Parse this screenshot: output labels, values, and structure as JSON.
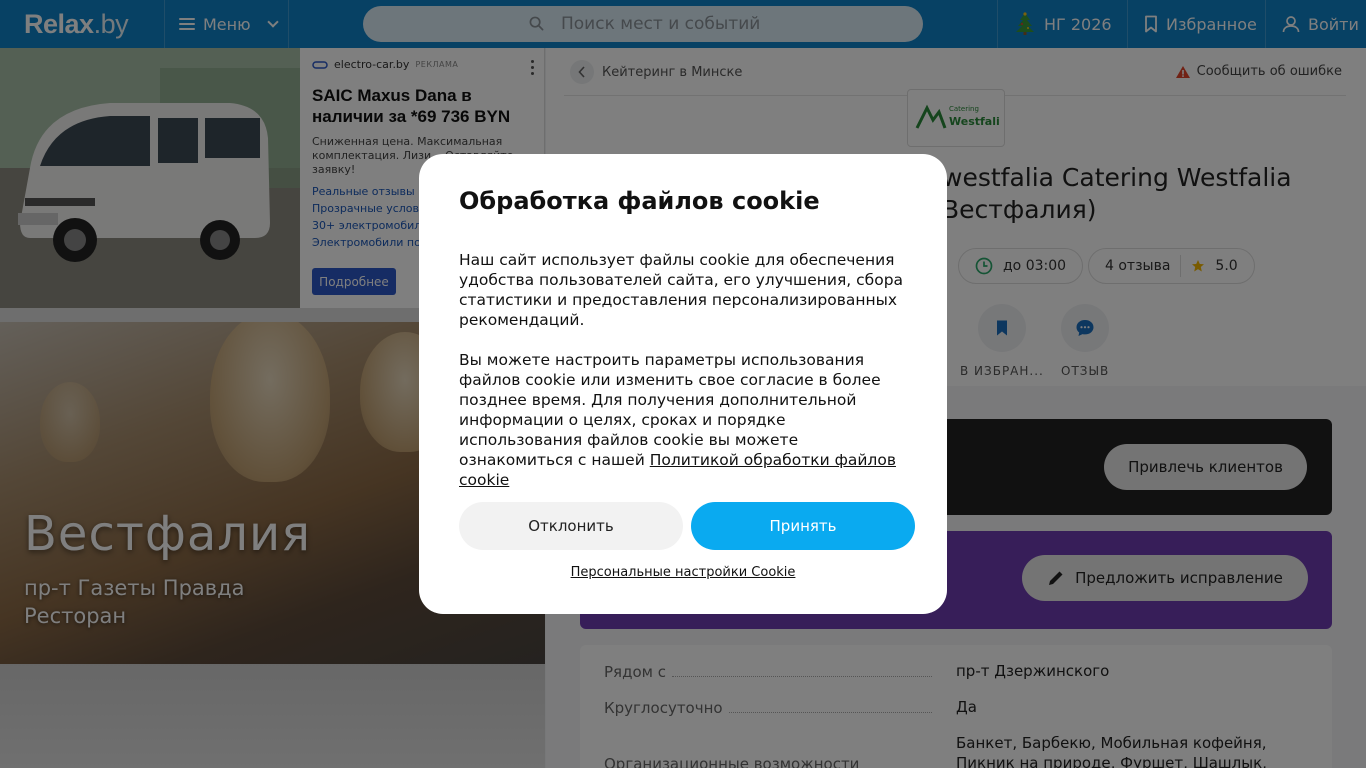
{
  "header": {
    "logo_main": "Relax",
    "logo_suffix": ".by",
    "menu_label": "Меню",
    "search_placeholder": "Поиск мест и событий",
    "ng_label": "НГ 2026",
    "favorites_label": "Избранное",
    "login_label": "Войти"
  },
  "ad": {
    "brand": "electro-car.by",
    "tag": "РЕКЛАМА",
    "title": "SAIC Maxus Dana в наличии за *69 736 BYN",
    "description": "Сниженная цена. Максимальная комплектация. Лизи... Оставляйте заявку!",
    "links": [
      "Реальные отзывы",
      "Прозрачные услови...",
      "30+ электромобиле...",
      "Электромобили по..."
    ],
    "button": "Подробнее"
  },
  "hero": {
    "title": "Вестфалия",
    "address": "пр-т Газеты Правда",
    "type": "Ресторан"
  },
  "place": {
    "breadcrumb": "Кейтеринг в Минске",
    "report_error": "Сообщить об ошибке",
    "logo_text": "Westfalia",
    "logo_caption": "Catering",
    "title_line1": "westfalia Catering Westfalia",
    "title_line2": "Вестфалия)",
    "hours": "до 03:00",
    "reviews": "4 отзыва",
    "rating": "5.0",
    "actions": {
      "favorite": "В ИЗБРАН...",
      "review": "ОТЗЫВ"
    }
  },
  "promo": {
    "attract_button": "Привлечь клиентов",
    "suggest_button": "Предложить исправление"
  },
  "info": [
    {
      "key": "Рядом с",
      "value": "пр-т Дзержинского"
    },
    {
      "key": "Круглосуточно",
      "value": "Да"
    },
    {
      "key": "Организационные возможности",
      "value": "Банкет, Барбекю, Мобильная кофейня, Пикник на природе, Фуршет, Шашлык,"
    }
  ],
  "cookie": {
    "title": "Обработка файлов cookie",
    "paragraph1": "Наш сайт использует файлы cookie для обеспечения удобства пользователей сайта, его улучшения, сбора статистики и предоставления персонализированных рекомендаций.",
    "paragraph2": "Вы можете настроить параметры использования файлов cookie или изменить свое согласие в более позднее время. Для получения дополнительной информации о целях, сроках и порядке использования файлов cookie вы можете ознакомиться с нашей ",
    "policy_link": "Политикой обработки файлов cookie",
    "decline": "Отклонить",
    "accept": "Принять",
    "personal_settings": "Персональные настройки Cookie"
  },
  "colors": {
    "header_bg": "#0e83c9",
    "accept_button": "#0aaaf0",
    "promo_purple": "#6f3cb3",
    "ad_button": "#2d58c8"
  }
}
